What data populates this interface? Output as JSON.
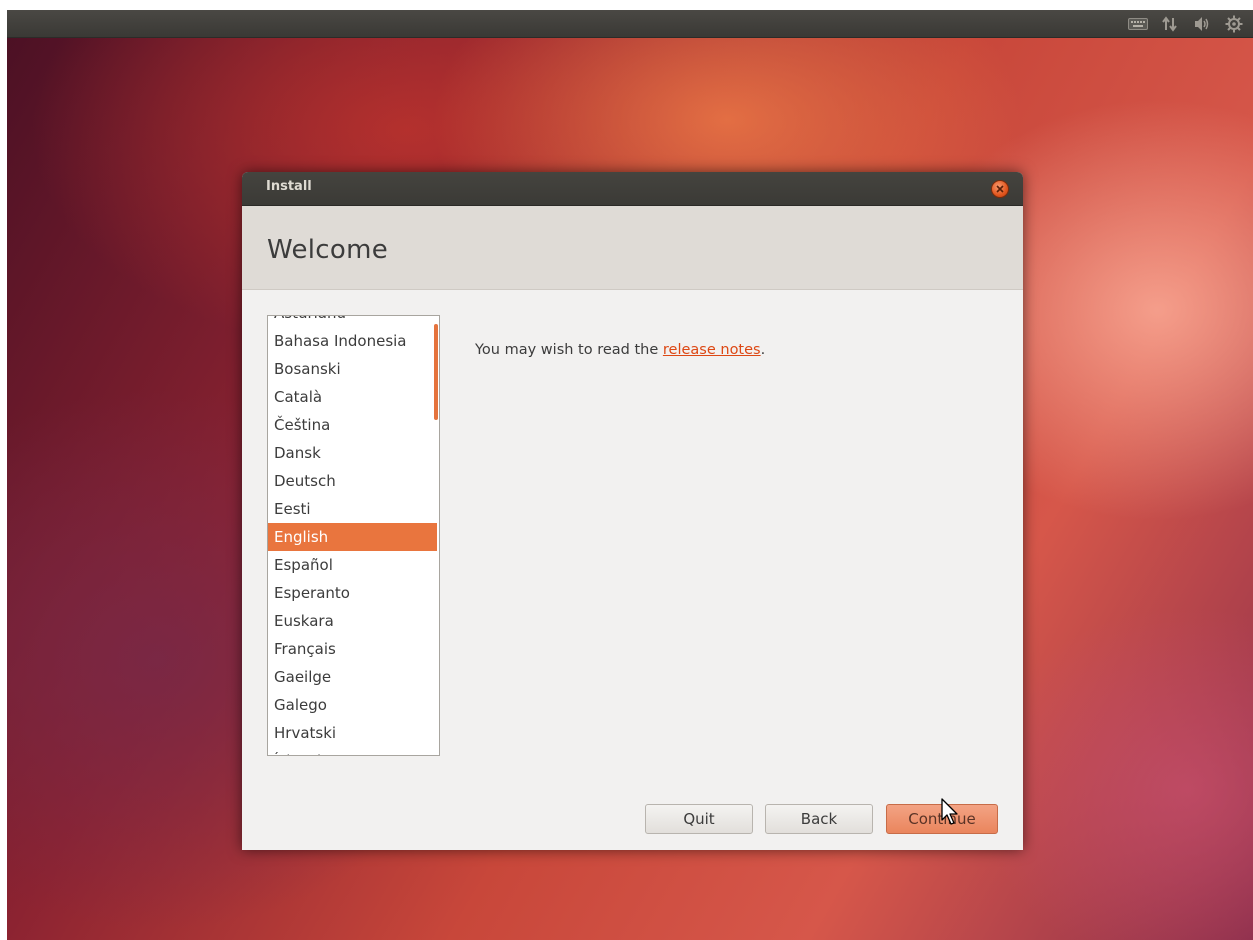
{
  "top_panel": {
    "indicators": [
      "keyboard-icon",
      "network-icon",
      "sound-icon",
      "session-gear-icon"
    ]
  },
  "window": {
    "title": "Install",
    "close_icon": "close-icon",
    "page_title": "Welcome"
  },
  "language_list": {
    "items": [
      "Asturianu",
      "Bahasa Indonesia",
      "Bosanski",
      "Català",
      "Čeština",
      "Dansk",
      "Deutsch",
      "Eesti",
      "English",
      "Español",
      "Esperanto",
      "Euskara",
      "Français",
      "Gaeilge",
      "Galego",
      "Hrvatski",
      "Íslenska"
    ],
    "selected": "English"
  },
  "release_notes": {
    "prefix": "You may wish to read the ",
    "link": "release notes",
    "suffix": "."
  },
  "buttons": {
    "quit": "Quit",
    "back": "Back",
    "continue": "Continue"
  },
  "colors": {
    "accent": "#e9753e",
    "link": "#dd4814"
  }
}
